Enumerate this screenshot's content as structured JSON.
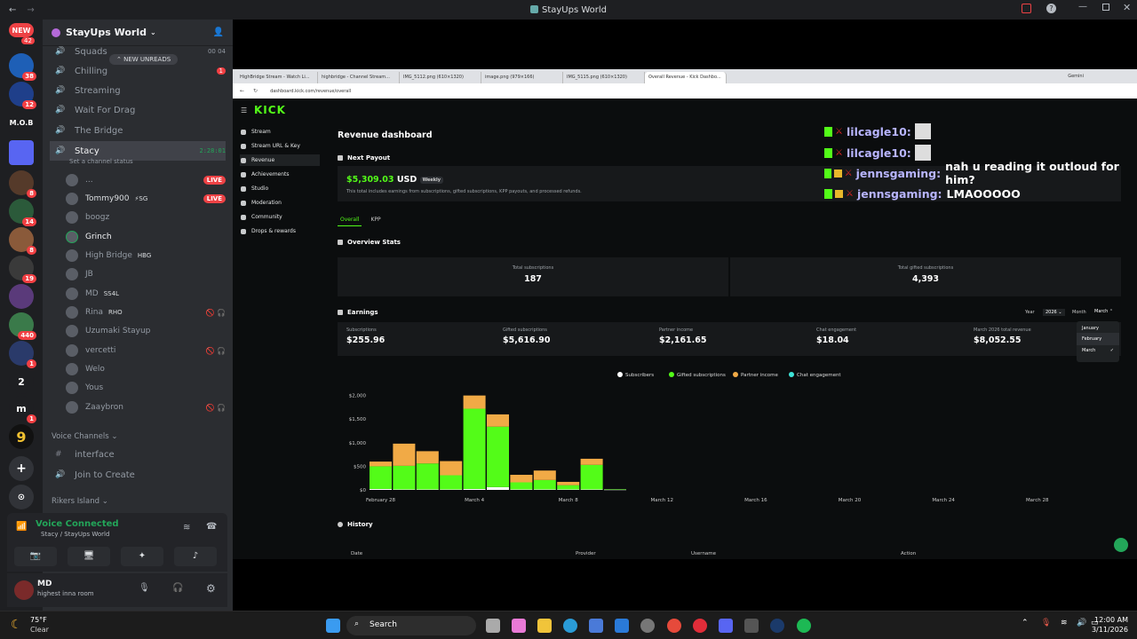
{
  "window": {
    "title": "StayUps World"
  },
  "server_rail": {
    "new_label": "NEW",
    "new_count": "42",
    "badges": [
      "38",
      "12",
      "8",
      "14",
      "8",
      "19",
      "440",
      "1",
      "1"
    ],
    "mob_label": "M.O.B",
    "two_label": "2",
    "m_label": "m",
    "nine_label": "9"
  },
  "guild": {
    "name": "StayUps World",
    "new_unreads": "NEW UNREADS"
  },
  "channels": [
    {
      "name": "Squads",
      "meta": "00  04"
    },
    {
      "name": "Chilling",
      "meta": "1"
    },
    {
      "name": "Streaming",
      "meta": ""
    },
    {
      "name": "Wait For Drag",
      "meta": ""
    },
    {
      "name": "The Bridge",
      "meta": ""
    }
  ],
  "current_channel": {
    "name": "Stacy",
    "time": "2:28:01",
    "status": "Set a channel status"
  },
  "voice_users": [
    {
      "name": "...",
      "tag": "",
      "live": "LIVE"
    },
    {
      "name": "Tommy900",
      "tag": "⚡SG",
      "live": "LIVE"
    },
    {
      "name": "boogz",
      "tag": "",
      "live": ""
    },
    {
      "name": "Grinch",
      "tag": "",
      "live": ""
    },
    {
      "name": "High Bridge",
      "tag": "HBG",
      "live": ""
    },
    {
      "name": "JB",
      "tag": "",
      "live": ""
    },
    {
      "name": "MD",
      "tag": "SS4L",
      "live": ""
    },
    {
      "name": "Rina",
      "tag": "RHO",
      "live": ""
    },
    {
      "name": "Uzumaki Stayup",
      "tag": "",
      "live": ""
    },
    {
      "name": "vercetti",
      "tag": "",
      "live": ""
    },
    {
      "name": "Welo",
      "tag": "",
      "live": ""
    },
    {
      "name": "Yous",
      "tag": "",
      "live": ""
    },
    {
      "name": "Zaaybron",
      "tag": "",
      "live": ""
    }
  ],
  "voice_channels_label": "Voice Channels",
  "voice_channel_items": [
    "interface",
    "Join to Create"
  ],
  "category_rikers": "Rikers Island",
  "voice_panel": {
    "status": "Voice Connected",
    "location": "Stacy / StayUps World"
  },
  "user_panel": {
    "name": "MD",
    "status": "highest inna room"
  },
  "browser": {
    "tabs": [
      "HighBridge Stream - Watch Li...",
      "highbridge - Channel Stream...",
      "IMG_5112.png (610×1320)",
      "image.png (979×166)",
      "IMG_5115.png (610×1320)",
      "Overall Revenue - Kick Dashbo..."
    ],
    "url": "dashboard.kick.com/revenue/overall",
    "gemini": "Gemini"
  },
  "kick": {
    "logo": "KICK",
    "nav": [
      "Stream",
      "Stream URL & Key",
      "Revenue",
      "Achievements",
      "Studio",
      "Moderation",
      "Community",
      "Drops & rewards"
    ],
    "page_title": "Revenue dashboard",
    "next_payout_label": "Next Payout",
    "payout_amount": "$5,309.03",
    "payout_currency": "USD",
    "payout_freq": "Weekly",
    "payout_note": "This total includes earnings from subscriptions, gifted subscriptions, KPP payouts, and processed refunds.",
    "tabs": [
      "Overall",
      "KPP"
    ],
    "overview_label": "Overview Stats",
    "total_subs_label": "Total subscriptions",
    "total_subs": "187",
    "total_gifted_label": "Total gifted subscriptions",
    "total_gifted": "4,393",
    "earnings_label": "Earnings",
    "year_label": "Year",
    "year_value": "2026",
    "month_label": "Month",
    "month_value": "March",
    "month_options": [
      "January",
      "February",
      "March"
    ],
    "earnings": [
      {
        "label": "Subscriptions",
        "value": "$255.96"
      },
      {
        "label": "Gifted subscriptions",
        "value": "$5,616.90"
      },
      {
        "label": "Partner income",
        "value": "$2,161.65"
      },
      {
        "label": "Chat engagement",
        "value": "$18.04"
      },
      {
        "label": "March 2026 total revenue",
        "value": "$8,052.55"
      }
    ],
    "history_label": "History",
    "history_cols": [
      "Date",
      "Provider",
      "Username",
      "Action"
    ]
  },
  "chat": [
    {
      "user": "lilcagle10:",
      "msg": ""
    },
    {
      "user": "lilcagle10:",
      "msg": ""
    },
    {
      "user": "jennsgaming:",
      "msg": "nah u reading it outloud for him?"
    },
    {
      "user": "jennsgaming:",
      "msg": "LMAOOOOO"
    }
  ],
  "chart_data": {
    "type": "bar",
    "stacked": true,
    "legend_position": "top",
    "categories": [
      "Feb 28",
      "Mar 1",
      "Mar 2",
      "Mar 3",
      "Mar 4",
      "Mar 5",
      "Mar 6",
      "Mar 7",
      "Mar 8",
      "Mar 9",
      "Mar 10"
    ],
    "x_tick_labels": [
      "February 28",
      "March 4",
      "March 8",
      "March 12",
      "March 16",
      "March 20",
      "March 24",
      "March 28"
    ],
    "y_tick_labels": [
      "$0",
      "$500",
      "$1,000",
      "$1,500",
      "$2,000"
    ],
    "ylim": [
      0,
      2200
    ],
    "series": [
      {
        "name": "Subscribers",
        "color": "#ffffff",
        "values": [
          20,
          10,
          10,
          10,
          20,
          60,
          10,
          10,
          10,
          10,
          5
        ]
      },
      {
        "name": "Gifted subscriptions",
        "color": "#53fc18",
        "values": [
          480,
          500,
          550,
          300,
          1700,
          1280,
          150,
          200,
          90,
          520,
          10
        ]
      },
      {
        "name": "Partner income",
        "color": "#f1aa46",
        "values": [
          100,
          470,
          260,
          300,
          280,
          260,
          160,
          200,
          70,
          130,
          0
        ]
      },
      {
        "name": "Chat engagement",
        "color": "#3ee4d8",
        "values": [
          0,
          0,
          0,
          0,
          0,
          0,
          0,
          0,
          0,
          0,
          0
        ]
      }
    ]
  },
  "taskbar": {
    "weather_temp": "75°F",
    "weather_desc": "Clear",
    "search": "Search",
    "time": "12:00 AM",
    "date": "3/11/2026"
  }
}
